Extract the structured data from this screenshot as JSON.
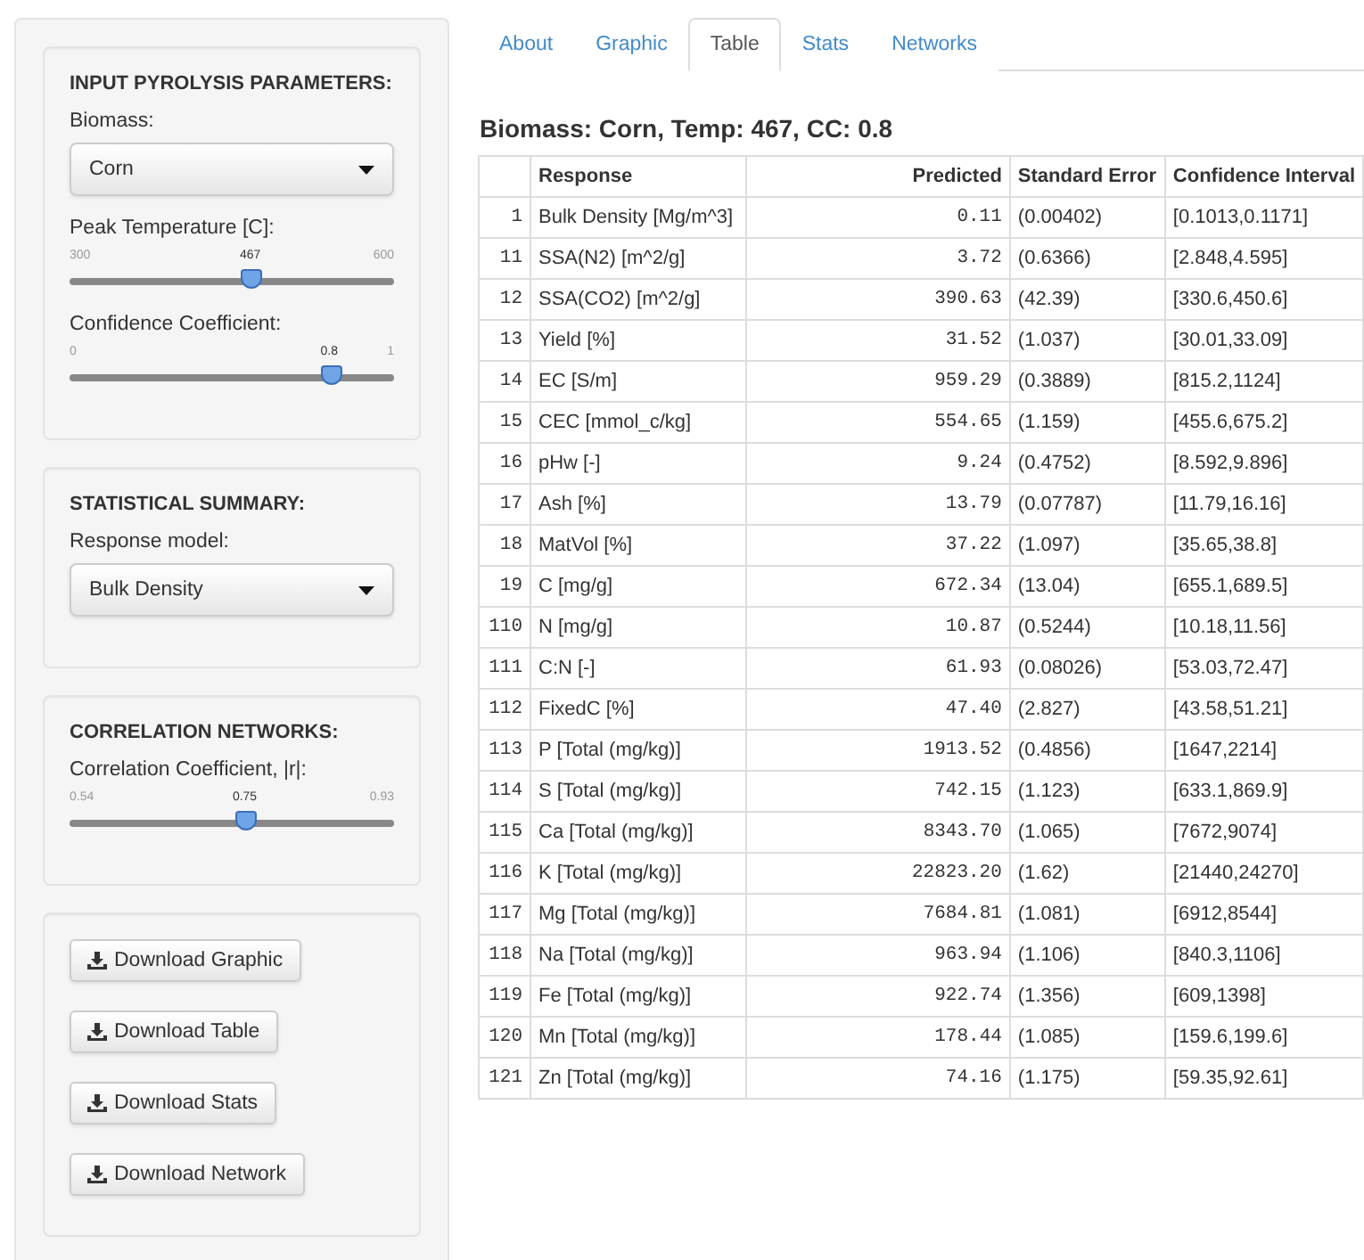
{
  "sidebar": {
    "panels": [
      {
        "kind": "inputs",
        "title": "INPUT PYROLYSIS PARAMETERS:",
        "controls": [
          {
            "kind": "select",
            "label": "Biomass:",
            "value": "Corn"
          },
          {
            "kind": "slider",
            "label": "Peak Temperature [C]:",
            "min": "300",
            "max": "600",
            "value": "467",
            "level": 0.557
          },
          {
            "kind": "slider",
            "label": "Confidence Coefficient:",
            "min": "0",
            "max": "1",
            "value": "0.8",
            "level": 0.8
          }
        ]
      },
      {
        "kind": "inputs",
        "title": "STATISTICAL SUMMARY:",
        "controls": [
          {
            "kind": "select",
            "label": "Response model:",
            "value": "Bulk Density"
          }
        ]
      },
      {
        "kind": "inputs",
        "title": "CORRELATION NETWORKS:",
        "controls": [
          {
            "kind": "slider",
            "label": "Correlation Coefficient, |r|:",
            "min": "0.54",
            "max": "0.93",
            "value": "0.75",
            "level": 0.54
          }
        ]
      },
      {
        "kind": "downloads",
        "buttons": [
          "Download Graphic",
          "Download Table",
          "Download Stats",
          "Download Network"
        ]
      }
    ]
  },
  "tabs": [
    {
      "label": "About",
      "selected": false
    },
    {
      "label": "Graphic",
      "selected": false
    },
    {
      "label": "Table",
      "selected": true
    },
    {
      "label": "Stats",
      "selected": false
    },
    {
      "label": "Networks",
      "selected": false
    }
  ],
  "heading": "Biomass: Corn, Temp: 467, CC: 0.8",
  "table": {
    "columns": [
      "Response",
      "Predicted",
      "Standard Error",
      "Confidence Interval"
    ],
    "rows": [
      {
        "index": "1",
        "response": "Bulk Density [Mg/m^3]",
        "predicted": "0.11",
        "std_error": "(0.00402)",
        "ci": "[0.1013,0.1171]"
      },
      {
        "index": "11",
        "response": "SSA(N2) [m^2/g]",
        "predicted": "3.72",
        "std_error": "(0.6366)",
        "ci": "[2.848,4.595]"
      },
      {
        "index": "12",
        "response": "SSA(CO2) [m^2/g]",
        "predicted": "390.63",
        "std_error": "(42.39)",
        "ci": "[330.6,450.6]"
      },
      {
        "index": "13",
        "response": "Yield [%]",
        "predicted": "31.52",
        "std_error": "(1.037)",
        "ci": "[30.01,33.09]"
      },
      {
        "index": "14",
        "response": "EC [S/m]",
        "predicted": "959.29",
        "std_error": "(0.3889)",
        "ci": "[815.2,1124]"
      },
      {
        "index": "15",
        "response": "CEC [mmol_c/kg]",
        "predicted": "554.65",
        "std_error": "(1.159)",
        "ci": "[455.6,675.2]"
      },
      {
        "index": "16",
        "response": "pHw [-]",
        "predicted": "9.24",
        "std_error": "(0.4752)",
        "ci": "[8.592,9.896]"
      },
      {
        "index": "17",
        "response": "Ash [%]",
        "predicted": "13.79",
        "std_error": "(0.07787)",
        "ci": "[11.79,16.16]"
      },
      {
        "index": "18",
        "response": "MatVol [%]",
        "predicted": "37.22",
        "std_error": "(1.097)",
        "ci": "[35.65,38.8]"
      },
      {
        "index": "19",
        "response": "C [mg/g]",
        "predicted": "672.34",
        "std_error": "(13.04)",
        "ci": "[655.1,689.5]"
      },
      {
        "index": "110",
        "response": "N [mg/g]",
        "predicted": "10.87",
        "std_error": "(0.5244)",
        "ci": "[10.18,11.56]"
      },
      {
        "index": "111",
        "response": "C:N [-]",
        "predicted": "61.93",
        "std_error": "(0.08026)",
        "ci": "[53.03,72.47]"
      },
      {
        "index": "112",
        "response": "FixedC [%]",
        "predicted": "47.40",
        "std_error": "(2.827)",
        "ci": "[43.58,51.21]"
      },
      {
        "index": "113",
        "response": "P [Total (mg/kg)]",
        "predicted": "1913.52",
        "std_error": "(0.4856)",
        "ci": "[1647,2214]"
      },
      {
        "index": "114",
        "response": "S [Total (mg/kg)]",
        "predicted": "742.15",
        "std_error": "(1.123)",
        "ci": "[633.1,869.9]"
      },
      {
        "index": "115",
        "response": "Ca [Total (mg/kg)]",
        "predicted": "8343.70",
        "std_error": "(1.065)",
        "ci": "[7672,9074]"
      },
      {
        "index": "116",
        "response": "K [Total (mg/kg)]",
        "predicted": "22823.20",
        "std_error": "(1.62)",
        "ci": "[21440,24270]"
      },
      {
        "index": "117",
        "response": "Mg [Total (mg/kg)]",
        "predicted": "7684.81",
        "std_error": "(1.081)",
        "ci": "[6912,8544]"
      },
      {
        "index": "118",
        "response": "Na [Total (mg/kg)]",
        "predicted": "963.94",
        "std_error": "(1.106)",
        "ci": "[840.3,1106]"
      },
      {
        "index": "119",
        "response": "Fe [Total (mg/kg)]",
        "predicted": "922.74",
        "std_error": "(1.356)",
        "ci": "[609,1398]"
      },
      {
        "index": "120",
        "response": "Mn [Total (mg/kg)]",
        "predicted": "178.44",
        "std_error": "(1.085)",
        "ci": "[159.6,199.6]"
      },
      {
        "index": "121",
        "response": "Zn [Total (mg/kg)]",
        "predicted": "74.16",
        "std_error": "(1.175)",
        "ci": "[59.35,92.61]"
      }
    ]
  }
}
